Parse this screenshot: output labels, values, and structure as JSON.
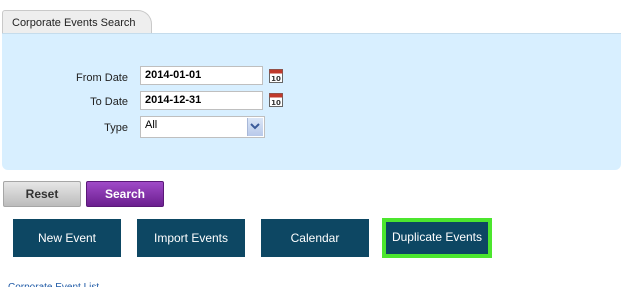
{
  "tab": {
    "label": "Corporate Events Search"
  },
  "form": {
    "from_date": {
      "label": "From Date",
      "value": "2014-01-01"
    },
    "to_date": {
      "label": "To Date",
      "value": "2014-12-31"
    },
    "type": {
      "label": "Type",
      "value": "All"
    }
  },
  "actions": {
    "reset_label": "Reset",
    "search_label": "Search"
  },
  "nav_buttons": {
    "new_event": "New Event",
    "import_events": "Import Events",
    "calendar": "Calendar",
    "duplicate_events": "Duplicate Events"
  },
  "footer": {
    "link": "Corporate Event List"
  },
  "colors": {
    "panel_bg": "#d8efff",
    "nav_bg": "#0d4763",
    "search_bg": "#7a2a9e",
    "highlight": "#4ce62e"
  }
}
